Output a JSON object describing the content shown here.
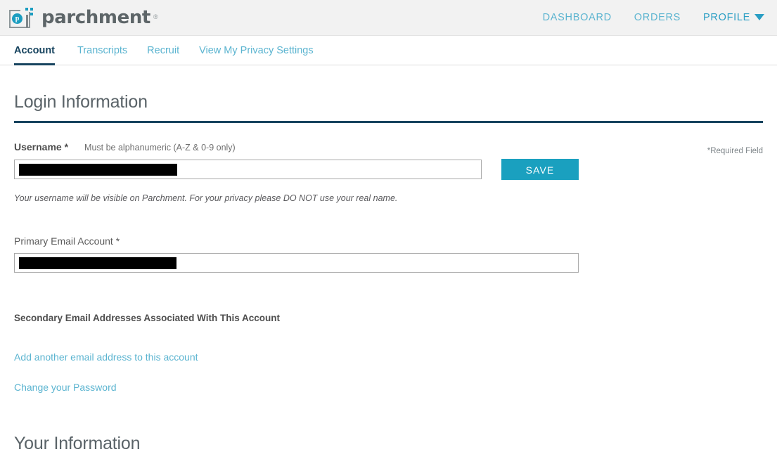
{
  "header": {
    "brand_name": "parchment",
    "brand_tm": "®",
    "brand_icon_letter": "p",
    "nav": [
      {
        "label": "DASHBOARD",
        "active": false
      },
      {
        "label": "ORDERS",
        "active": false
      },
      {
        "label": "PROFILE",
        "active": true,
        "has_caret": true
      }
    ]
  },
  "tabs": [
    {
      "label": "Account",
      "active": true
    },
    {
      "label": "Transcripts",
      "active": false
    },
    {
      "label": "Recruit",
      "active": false
    },
    {
      "label": "View My Privacy Settings",
      "active": false
    }
  ],
  "main": {
    "section_title": "Login Information",
    "required_note": "*Required Field",
    "username": {
      "label": "Username *",
      "hint": "Must be alphanumeric (A-Z & 0-9 only)",
      "value": "",
      "placeholder": "",
      "redacted": true,
      "save_label": "SAVE",
      "note": "Your username will be visible on Parchment. For your privacy please DO NOT use your real name."
    },
    "primary_email": {
      "label": "Primary Email Account *",
      "value": "",
      "placeholder": "",
      "redacted": true
    },
    "secondary_emails_heading": "Secondary Email Addresses Associated With This Account",
    "links": [
      {
        "label": "Add another email address to this account"
      },
      {
        "label": "Change your Password"
      }
    ],
    "next_section_title": "Your Information"
  },
  "colors": {
    "accent_teal": "#1aa0bf",
    "link_blue": "#5bb4d0",
    "nav_active_blue": "#2a9ec4",
    "dark_navy": "#16435e",
    "header_bg": "#f2f2f2",
    "text_grey": "#4e4e4e"
  }
}
